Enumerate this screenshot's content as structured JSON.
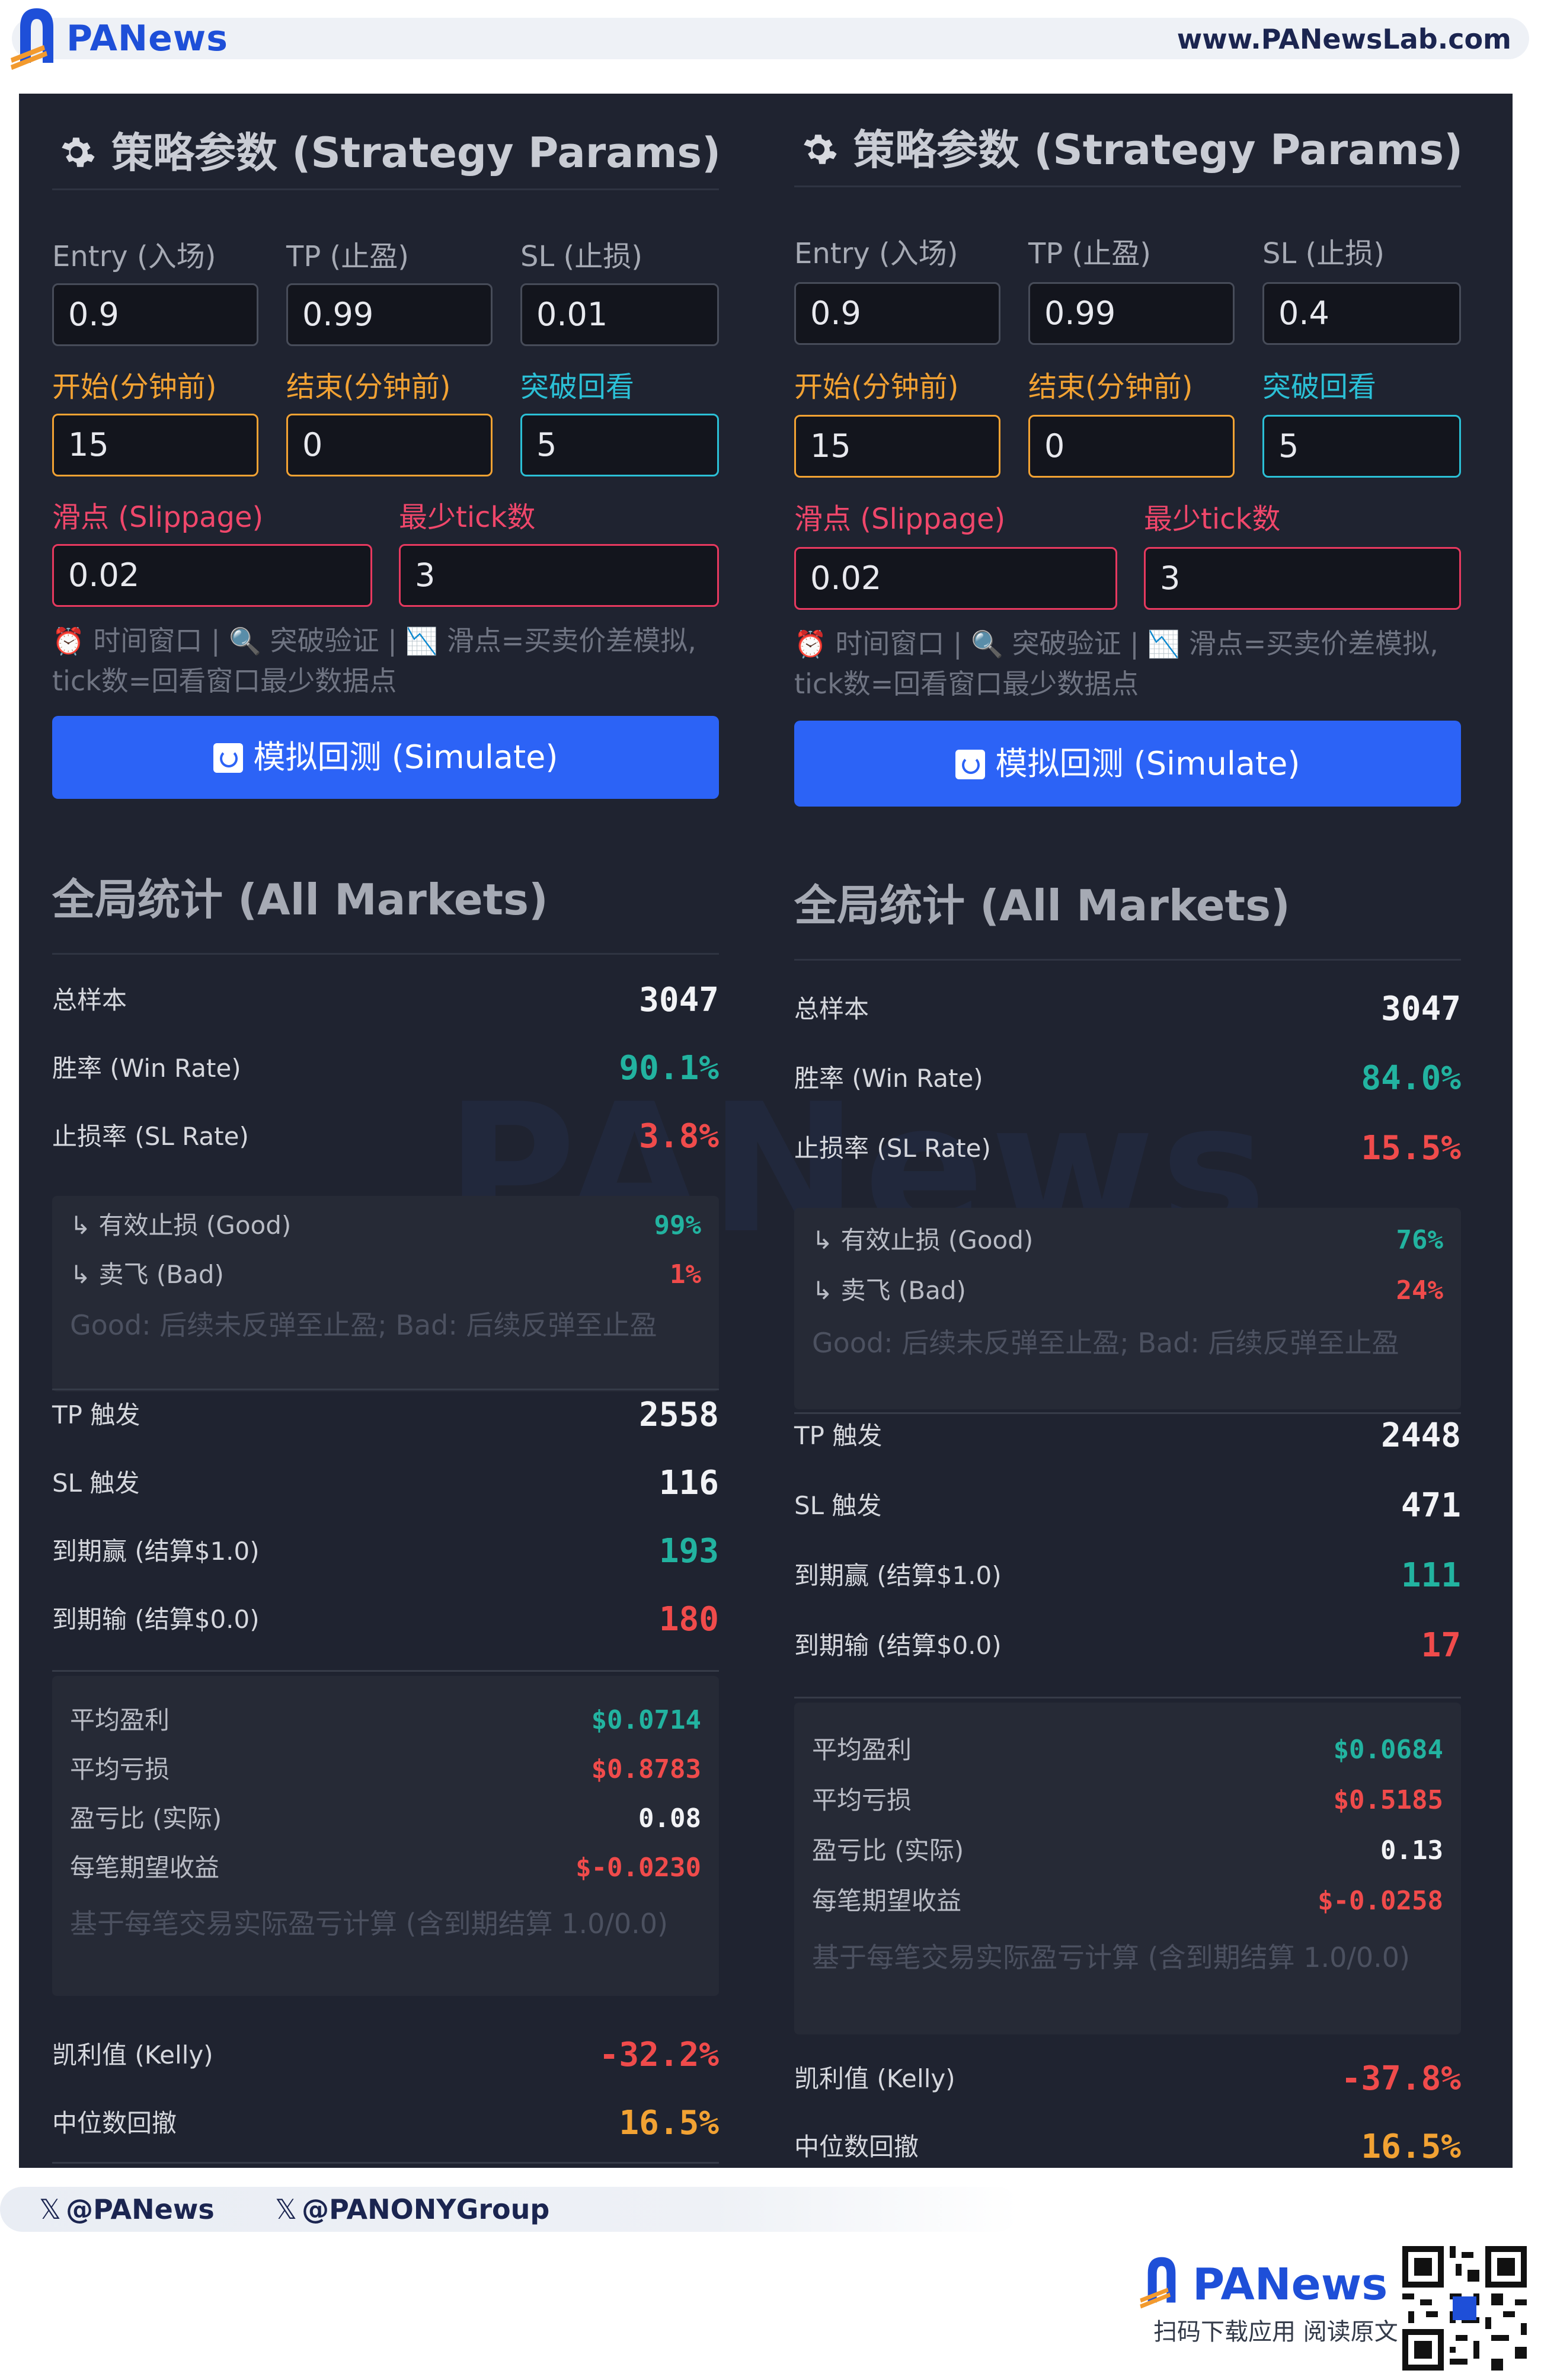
{
  "header": {
    "brand": "PANews",
    "site_url": "www.PANewsLab.com"
  },
  "watermark": "PANews",
  "columns": [
    {
      "title": "策略参数 (Strategy Params)",
      "params": {
        "entry_label": "Entry (入场)",
        "entry_value": "0.9",
        "tp_label": "TP (止盈)",
        "tp_value": "0.99",
        "sl_label": "SL (止损)",
        "sl_value": "0.01",
        "start_label": "开始(分钟前)",
        "start_value": "15",
        "end_label": "结束(分钟前)",
        "end_value": "0",
        "lookback_label": "突破回看",
        "lookback_value": "5",
        "slippage_label": "滑点 (Slippage)",
        "slippage_value": "0.02",
        "min_tick_label": "最少tick数",
        "min_tick_value": "3"
      },
      "hint": {
        "alarm_icon": "⏰",
        "part1": "时间窗口 | ",
        "search_icon": "🔍",
        "part2": "突破验证 | ",
        "chart_icon": "📉",
        "part3": "滑点=买卖价差模拟, tick数=回看窗口最少数据点"
      },
      "simulate_label": "模拟回测 (Simulate)",
      "stats_title": "全局统计 (All Markets)",
      "stats": {
        "total_label": "总样本",
        "total_value": "3047",
        "win_label": "胜率 (Win Rate)",
        "win_value": "90.1%",
        "sl_rate_label": "止损率 (SL Rate)",
        "sl_rate_value": "3.8%"
      },
      "sl_breakdown": {
        "good_label": "↳ 有效止损 (Good)",
        "good_value": "99%",
        "bad_label": "↳ 卖飞 (Bad)",
        "bad_value": "1%",
        "note": "Good: 后续未反弹至止盈; Bad: 后续反弹至止盈"
      },
      "triggers": {
        "tp_label": "TP 触发",
        "tp_value": "2558",
        "sl_label": "SL 触发",
        "sl_value": "116",
        "win_label": "到期赢 (结算$1.0)",
        "win_value": "193",
        "lose_label": "到期输 (结算$0.0)",
        "lose_value": "180"
      },
      "pnl": {
        "avg_profit_label": "平均盈利",
        "avg_profit_value": "$0.0714",
        "avg_loss_label": "平均亏损",
        "avg_loss_value": "$0.8783",
        "ratio_label": "盈亏比 (实际)",
        "ratio_value": "0.08",
        "expect_label": "每笔期望收益",
        "expect_value": "$-0.0230",
        "note": "基于每笔交易实际盈亏计算 (含到期结算 1.0/0.0)"
      },
      "risk": {
        "kelly_label": "凯利值 (Kelly)",
        "kelly_value": "-32.2%",
        "drawdown_label": "中位数回撤",
        "drawdown_value": "16.5%"
      }
    },
    {
      "title": "策略参数 (Strategy Params)",
      "params": {
        "entry_label": "Entry (入场)",
        "entry_value": "0.9",
        "tp_label": "TP (止盈)",
        "tp_value": "0.99",
        "sl_label": "SL (止损)",
        "sl_value": "0.4",
        "start_label": "开始(分钟前)",
        "start_value": "15",
        "end_label": "结束(分钟前)",
        "end_value": "0",
        "lookback_label": "突破回看",
        "lookback_value": "5",
        "slippage_label": "滑点 (Slippage)",
        "slippage_value": "0.02",
        "min_tick_label": "最少tick数",
        "min_tick_value": "3"
      },
      "hint": {
        "alarm_icon": "⏰",
        "part1": "时间窗口 | ",
        "search_icon": "🔍",
        "part2": "突破验证 | ",
        "chart_icon": "📉",
        "part3": "滑点=买卖价差模拟, tick数=回看窗口最少数据点"
      },
      "simulate_label": "模拟回测 (Simulate)",
      "stats_title": "全局统计 (All Markets)",
      "stats": {
        "total_label": "总样本",
        "total_value": "3047",
        "win_label": "胜率 (Win Rate)",
        "win_value": "84.0%",
        "sl_rate_label": "止损率 (SL Rate)",
        "sl_rate_value": "15.5%"
      },
      "sl_breakdown": {
        "good_label": "↳ 有效止损 (Good)",
        "good_value": "76%",
        "bad_label": "↳ 卖飞 (Bad)",
        "bad_value": "24%",
        "note": "Good: 后续未反弹至止盈; Bad: 后续反弹至止盈"
      },
      "triggers": {
        "tp_label": "TP 触发",
        "tp_value": "2448",
        "sl_label": "SL 触发",
        "sl_value": "471",
        "win_label": "到期赢 (结算$1.0)",
        "win_value": "111",
        "lose_label": "到期输 (结算$0.0)",
        "lose_value": "17"
      },
      "pnl": {
        "avg_profit_label": "平均盈利",
        "avg_profit_value": "$0.0684",
        "avg_loss_label": "平均亏损",
        "avg_loss_value": "$0.5185",
        "ratio_label": "盈亏比 (实际)",
        "ratio_value": "0.13",
        "expect_label": "每笔期望收益",
        "expect_value": "$-0.0258",
        "note": "基于每笔交易实际盈亏计算 (含到期结算 1.0/0.0)"
      },
      "risk": {
        "kelly_label": "凯利值 (Kelly)",
        "kelly_value": "-37.8%",
        "drawdown_label": "中位数回撤",
        "drawdown_value": "16.5%"
      }
    }
  ],
  "footer": {
    "x_handle_1": "@PANews",
    "x_handle_2": "@PANONYGroup",
    "brand": "PANews",
    "caption": "扫码下载应用  阅读原文"
  },
  "colors": {
    "brand_blue": "#1e4fd8",
    "panel_bg": "#1f2330",
    "button_blue": "#2c63f6",
    "positive": "#22b3a0",
    "negative": "#f04b4b",
    "accent_orange": "#f2a233",
    "accent_cyan": "#2bc0d6",
    "accent_pink": "#e7395f"
  }
}
